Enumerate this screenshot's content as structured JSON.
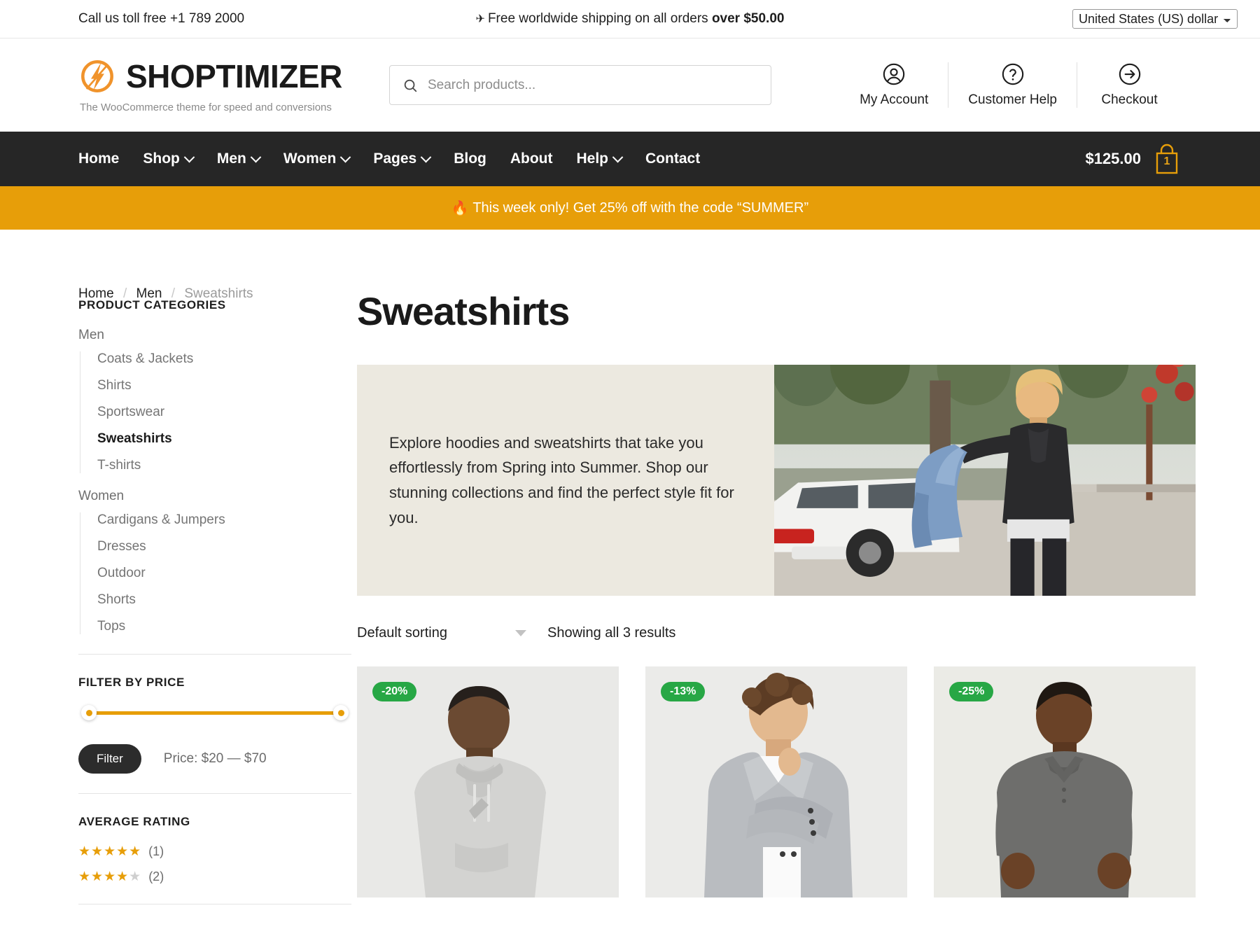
{
  "topbar": {
    "phone": "Call us toll free +1 789 2000",
    "plane_icon": "airplane-icon",
    "shipping_prefix": "Free worldwide shipping on all orders ",
    "shipping_bold": "over $50.00",
    "currency_selected": "United States (US) dollar",
    "currency_options": [
      "United States (US) dollar"
    ]
  },
  "header": {
    "brand_name": "SHOPTIMIZER",
    "tagline": "The WooCommerce theme for speed and conversions",
    "search_placeholder": "Search products...",
    "search_value": "",
    "actions": [
      {
        "label": "My Account",
        "icon": "user-circle-icon"
      },
      {
        "label": "Customer Help",
        "icon": "question-circle-icon"
      },
      {
        "label": "Checkout",
        "icon": "arrow-right-circle-icon"
      }
    ]
  },
  "nav": {
    "items": [
      {
        "label": "Home",
        "has_dropdown": false
      },
      {
        "label": "Shop",
        "has_dropdown": true
      },
      {
        "label": "Men",
        "has_dropdown": true
      },
      {
        "label": "Women",
        "has_dropdown": true
      },
      {
        "label": "Pages",
        "has_dropdown": true
      },
      {
        "label": "Blog",
        "has_dropdown": false
      },
      {
        "label": "About",
        "has_dropdown": false
      },
      {
        "label": "Help",
        "has_dropdown": true
      },
      {
        "label": "Contact",
        "has_dropdown": false
      }
    ],
    "cart_total": "$125.00",
    "cart_count": "1",
    "cart_icon": "shopping-bag-icon",
    "accent_color": "#e79e09",
    "bar_color": "#262626"
  },
  "promo": {
    "fire_icon": "🔥",
    "text": "This week only! Get 25% off with the code “SUMMER”",
    "background": "#e79e09"
  },
  "breadcrumb": {
    "home": "Home",
    "parent": "Men",
    "current": "Sweatshirts",
    "separator": "/"
  },
  "sidebar": {
    "categories_title": "Product Categories",
    "groups": [
      {
        "parent": "Men",
        "children": [
          {
            "label": "Coats & Jackets",
            "active": false
          },
          {
            "label": "Shirts",
            "active": false
          },
          {
            "label": "Sportswear",
            "active": false
          },
          {
            "label": "Sweatshirts",
            "active": true
          },
          {
            "label": "T-shirts",
            "active": false
          }
        ]
      },
      {
        "parent": "Women",
        "children": [
          {
            "label": "Cardigans & Jumpers",
            "active": false
          },
          {
            "label": "Dresses",
            "active": false
          },
          {
            "label": "Outdoor",
            "active": false
          },
          {
            "label": "Shorts",
            "active": false
          },
          {
            "label": "Tops",
            "active": false
          }
        ]
      }
    ],
    "price_title": "Filter By Price",
    "filter_button": "Filter",
    "price_range": "Price: $20 — $70",
    "price_min": "$20",
    "price_max": "$70",
    "rating_title": "Average Rating",
    "ratings": [
      {
        "stars": 5,
        "count": "(1)"
      },
      {
        "stars": 4,
        "count": "(2)"
      }
    ]
  },
  "main": {
    "page_title": "Sweatshirts",
    "hero_text": "Explore hoodies and sweatshirts that take you effortlessly from Spring into Summer. Shop our stunning collections and find the perfect style fit for you.",
    "hero_image_alt": "man-with-denim-jacket-photo",
    "sort_selected": "Default sorting",
    "sort_options": [
      "Default sorting"
    ],
    "results_text": "Showing all 3 results",
    "products": [
      {
        "badge": "-20%",
        "image_alt": "grey-hoodie-model-photo"
      },
      {
        "badge": "-13%",
        "image_alt": "grey-blazer-model-photo"
      },
      {
        "badge": "-25%",
        "image_alt": "grey-polo-model-photo"
      }
    ]
  }
}
